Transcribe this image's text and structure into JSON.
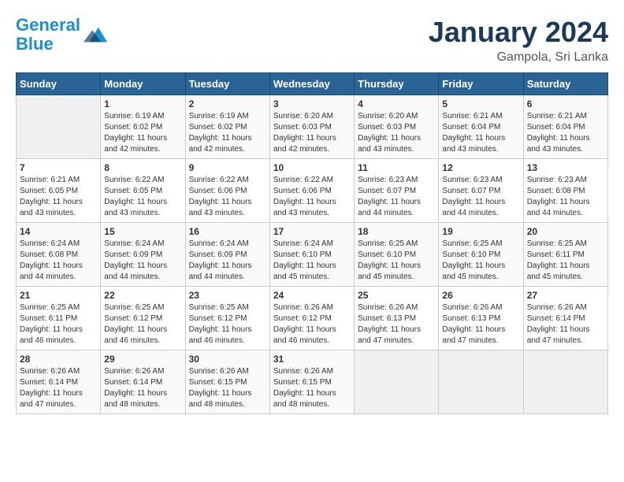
{
  "header": {
    "logo_line1": "General",
    "logo_line2": "Blue",
    "title": "January 2024",
    "subtitle": "Gampola, Sri Lanka"
  },
  "weekdays": [
    "Sunday",
    "Monday",
    "Tuesday",
    "Wednesday",
    "Thursday",
    "Friday",
    "Saturday"
  ],
  "weeks": [
    [
      {
        "day": "",
        "sunrise": "",
        "sunset": "",
        "daylight": ""
      },
      {
        "day": "1",
        "sunrise": "6:19 AM",
        "sunset": "6:02 PM",
        "daylight": "11 hours and 42 minutes."
      },
      {
        "day": "2",
        "sunrise": "6:19 AM",
        "sunset": "6:02 PM",
        "daylight": "11 hours and 42 minutes."
      },
      {
        "day": "3",
        "sunrise": "6:20 AM",
        "sunset": "6:03 PM",
        "daylight": "11 hours and 42 minutes."
      },
      {
        "day": "4",
        "sunrise": "6:20 AM",
        "sunset": "6:03 PM",
        "daylight": "11 hours and 43 minutes."
      },
      {
        "day": "5",
        "sunrise": "6:21 AM",
        "sunset": "6:04 PM",
        "daylight": "11 hours and 43 minutes."
      },
      {
        "day": "6",
        "sunrise": "6:21 AM",
        "sunset": "6:04 PM",
        "daylight": "11 hours and 43 minutes."
      }
    ],
    [
      {
        "day": "7",
        "sunrise": "6:21 AM",
        "sunset": "6:05 PM",
        "daylight": "11 hours and 43 minutes."
      },
      {
        "day": "8",
        "sunrise": "6:22 AM",
        "sunset": "6:05 PM",
        "daylight": "11 hours and 43 minutes."
      },
      {
        "day": "9",
        "sunrise": "6:22 AM",
        "sunset": "6:06 PM",
        "daylight": "11 hours and 43 minutes."
      },
      {
        "day": "10",
        "sunrise": "6:22 AM",
        "sunset": "6:06 PM",
        "daylight": "11 hours and 43 minutes."
      },
      {
        "day": "11",
        "sunrise": "6:23 AM",
        "sunset": "6:07 PM",
        "daylight": "11 hours and 44 minutes."
      },
      {
        "day": "12",
        "sunrise": "6:23 AM",
        "sunset": "6:07 PM",
        "daylight": "11 hours and 44 minutes."
      },
      {
        "day": "13",
        "sunrise": "6:23 AM",
        "sunset": "6:08 PM",
        "daylight": "11 hours and 44 minutes."
      }
    ],
    [
      {
        "day": "14",
        "sunrise": "6:24 AM",
        "sunset": "6:08 PM",
        "daylight": "11 hours and 44 minutes."
      },
      {
        "day": "15",
        "sunrise": "6:24 AM",
        "sunset": "6:09 PM",
        "daylight": "11 hours and 44 minutes."
      },
      {
        "day": "16",
        "sunrise": "6:24 AM",
        "sunset": "6:09 PM",
        "daylight": "11 hours and 44 minutes."
      },
      {
        "day": "17",
        "sunrise": "6:24 AM",
        "sunset": "6:10 PM",
        "daylight": "11 hours and 45 minutes."
      },
      {
        "day": "18",
        "sunrise": "6:25 AM",
        "sunset": "6:10 PM",
        "daylight": "11 hours and 45 minutes."
      },
      {
        "day": "19",
        "sunrise": "6:25 AM",
        "sunset": "6:10 PM",
        "daylight": "11 hours and 45 minutes."
      },
      {
        "day": "20",
        "sunrise": "6:25 AM",
        "sunset": "6:11 PM",
        "daylight": "11 hours and 45 minutes."
      }
    ],
    [
      {
        "day": "21",
        "sunrise": "6:25 AM",
        "sunset": "6:11 PM",
        "daylight": "11 hours and 46 minutes."
      },
      {
        "day": "22",
        "sunrise": "6:25 AM",
        "sunset": "6:12 PM",
        "daylight": "11 hours and 46 minutes."
      },
      {
        "day": "23",
        "sunrise": "6:25 AM",
        "sunset": "6:12 PM",
        "daylight": "11 hours and 46 minutes."
      },
      {
        "day": "24",
        "sunrise": "6:26 AM",
        "sunset": "6:12 PM",
        "daylight": "11 hours and 46 minutes."
      },
      {
        "day": "25",
        "sunrise": "6:26 AM",
        "sunset": "6:13 PM",
        "daylight": "11 hours and 47 minutes."
      },
      {
        "day": "26",
        "sunrise": "6:26 AM",
        "sunset": "6:13 PM",
        "daylight": "11 hours and 47 minutes."
      },
      {
        "day": "27",
        "sunrise": "6:26 AM",
        "sunset": "6:14 PM",
        "daylight": "11 hours and 47 minutes."
      }
    ],
    [
      {
        "day": "28",
        "sunrise": "6:26 AM",
        "sunset": "6:14 PM",
        "daylight": "11 hours and 47 minutes."
      },
      {
        "day": "29",
        "sunrise": "6:26 AM",
        "sunset": "6:14 PM",
        "daylight": "11 hours and 48 minutes."
      },
      {
        "day": "30",
        "sunrise": "6:26 AM",
        "sunset": "6:15 PM",
        "daylight": "11 hours and 48 minutes."
      },
      {
        "day": "31",
        "sunrise": "6:26 AM",
        "sunset": "6:15 PM",
        "daylight": "11 hours and 48 minutes."
      },
      {
        "day": "",
        "sunrise": "",
        "sunset": "",
        "daylight": ""
      },
      {
        "day": "",
        "sunrise": "",
        "sunset": "",
        "daylight": ""
      },
      {
        "day": "",
        "sunrise": "",
        "sunset": "",
        "daylight": ""
      }
    ]
  ],
  "labels": {
    "sunrise_prefix": "Sunrise: ",
    "sunset_prefix": "Sunset: ",
    "daylight_prefix": "Daylight: "
  }
}
